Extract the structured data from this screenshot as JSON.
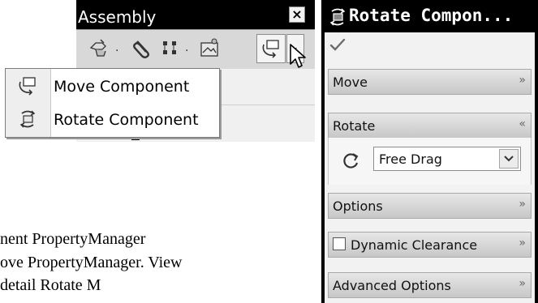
{
  "assembly_toolbar": {
    "title": "Assembly",
    "close_glyph": "×",
    "buttons": [
      {
        "icon": "insert-components-icon"
      },
      {
        "icon": "mate-icon"
      },
      {
        "icon": "linear-pattern-icon"
      },
      {
        "icon": "smart-fasteners-icon"
      },
      {
        "icon": "move-component-icon"
      },
      {
        "icon": "flyout-arrow-icon"
      }
    ]
  },
  "flyout_menu": {
    "items": [
      {
        "label": "Move Component",
        "icon": "move-component-icon"
      },
      {
        "label": "Rotate Component",
        "icon": "rotate-component-icon"
      }
    ]
  },
  "body_text": {
    "line1": "nent PropertyManager",
    "line2": "ove PropertyManager. View",
    "line3": "detail Rotate M"
  },
  "property_manager": {
    "title": "Rotate Compon...",
    "ok_icon": "ok-check-icon",
    "sections": {
      "move": {
        "label": "Move",
        "chevron": "»",
        "state": "collapsed"
      },
      "rotate": {
        "label": "Rotate",
        "chevron": "«",
        "state": "expanded"
      },
      "options": {
        "label": "Options",
        "chevron": "»",
        "state": "collapsed"
      },
      "dynamic_clearance": {
        "label": "Dynamic Clearance",
        "chevron": "»",
        "checked": false
      },
      "advanced_options": {
        "label": "Advanced Options",
        "chevron": "»",
        "state": "collapsed"
      }
    },
    "rotate_dropdown": {
      "selected": "Free Drag"
    }
  },
  "colors": {
    "title_bar": "#000000",
    "panel_bg": "#f2f2f2",
    "section_header_top": "#e7e7e7",
    "section_header_bottom": "#c7c7c7"
  }
}
